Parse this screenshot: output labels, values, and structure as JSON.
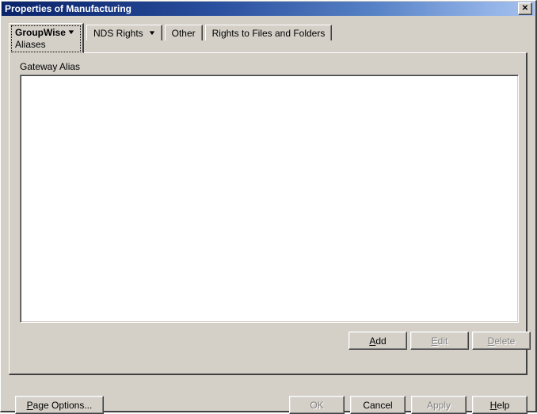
{
  "window": {
    "title": "Properties of Manufacturing",
    "close_label": "✕",
    "background_color": "#d4d0c8",
    "titlebar_start_color": "#0a246a",
    "titlebar_end_color": "#a6c0ec"
  },
  "tabs": [
    {
      "id": "groupwise",
      "label": "GroupWise",
      "sublabel": "Aliases",
      "caret": "▼",
      "selected": true,
      "has_dropdown": true
    },
    {
      "id": "nds-rights",
      "label": "NDS Rights",
      "caret": "▼",
      "selected": false,
      "has_dropdown": true
    },
    {
      "id": "other",
      "label": "Other",
      "selected": false,
      "has_dropdown": false
    },
    {
      "id": "rights-to-files-and-folders",
      "label": "Rights to Files and Folders",
      "selected": false,
      "has_dropdown": false
    }
  ],
  "page": {
    "group_label": "Gateway Alias",
    "listbox": {
      "items": [],
      "empty": true
    },
    "item_buttons": [
      {
        "id": "add",
        "label": "Add",
        "accel": "A",
        "enabled": true
      },
      {
        "id": "edit",
        "label": "Edit",
        "accel": "E",
        "enabled": false
      },
      {
        "id": "delete",
        "label": "Delete",
        "accel": "D",
        "enabled": false
      }
    ]
  },
  "footer": {
    "buttons": [
      {
        "id": "page-options",
        "label": "Page Options...",
        "accel": "P",
        "enabled": true
      },
      {
        "id": "ok",
        "label": "OK",
        "accel": "",
        "enabled": false
      },
      {
        "id": "cancel",
        "label": "Cancel",
        "accel": "",
        "enabled": true
      },
      {
        "id": "apply",
        "label": "Apply",
        "accel": "",
        "enabled": false
      },
      {
        "id": "help",
        "label": "Help",
        "accel": "H",
        "enabled": true
      }
    ]
  }
}
